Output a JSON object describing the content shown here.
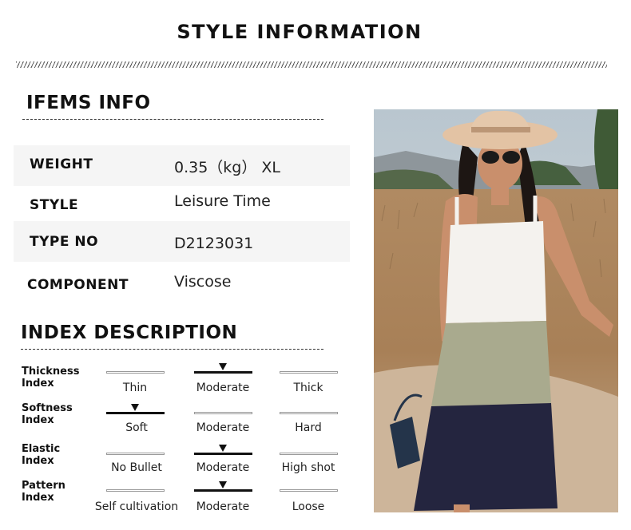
{
  "header": {
    "title": "STYLE INFORMATION"
  },
  "items_info": {
    "title": "IFEMS INFO",
    "rows": [
      {
        "label": "WEIGHT",
        "value": "0.35（kg） XL"
      },
      {
        "label": "STYLE",
        "value": "Leisure Time"
      },
      {
        "label": "TYPE NO",
        "value": "D2123031"
      },
      {
        "label": "COMPONENT",
        "value": "Viscose"
      }
    ]
  },
  "index_description": {
    "title": "INDEX DESCRIPTION",
    "indices": [
      {
        "label": "Thickness Index",
        "options": [
          "Thin",
          "Moderate",
          "Thick"
        ],
        "selected": 1
      },
      {
        "label": "Softness Index",
        "options": [
          "Soft",
          "Moderate",
          "Hard"
        ],
        "selected": 0
      },
      {
        "label": "Elastic Index",
        "options": [
          "No Bullet",
          "Moderate",
          "High shot"
        ],
        "selected": 1
      },
      {
        "label": "Pattern Index",
        "options": [
          "Self cultivation",
          "Moderate",
          "Loose"
        ],
        "selected": 1
      }
    ]
  },
  "product_photo": {
    "subject": "woman in tiered white, sage and navy sundress with wide-brim hat",
    "colors": {
      "sky": "#c9d3da",
      "field": "#b48a5c",
      "dress_top": "#f4f2ee",
      "dress_mid": "#a9aa8e",
      "dress_bottom": "#24253f",
      "hat": "#e3c3a4"
    }
  }
}
